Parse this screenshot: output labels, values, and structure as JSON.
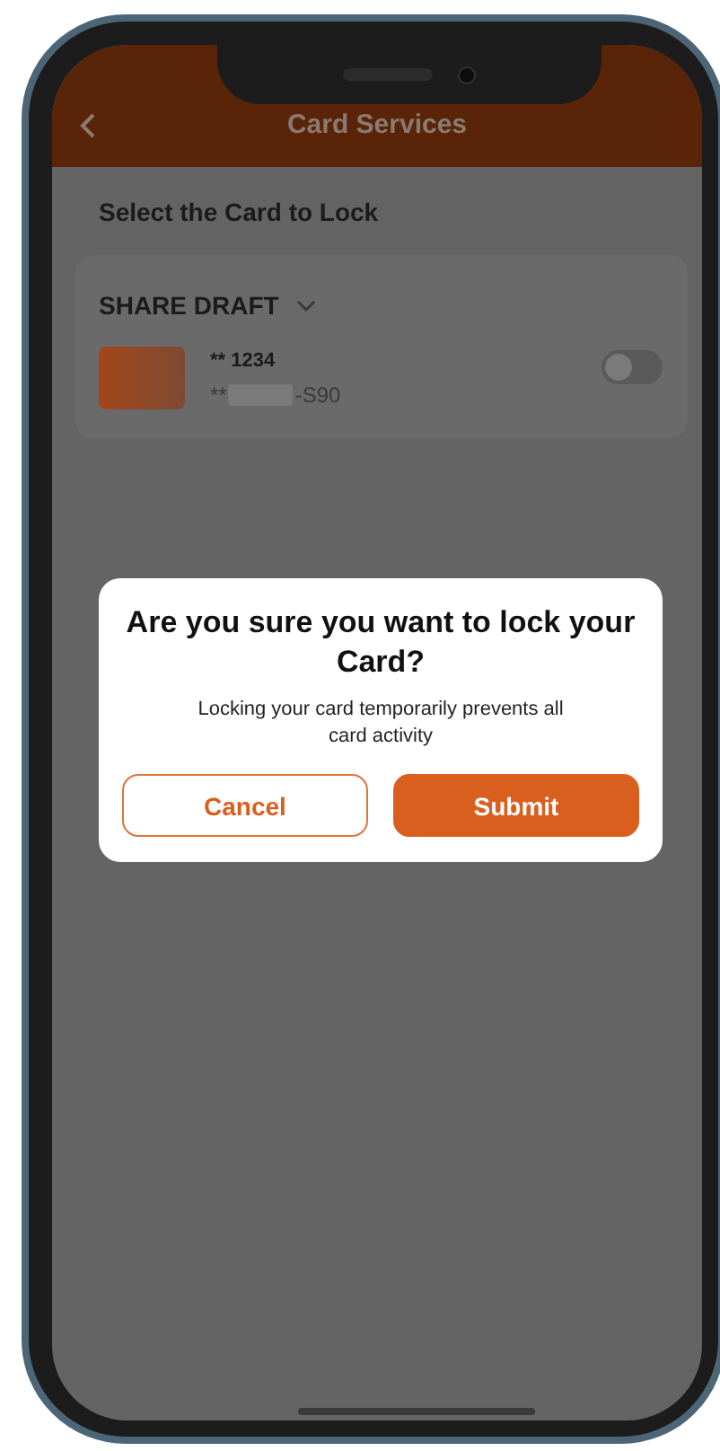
{
  "header": {
    "title": "Card Services"
  },
  "section_title": "Select the Card to Lock",
  "account": {
    "name": "SHARE DRAFT",
    "cards": [
      {
        "number": "** 1234",
        "masked": "**",
        "suffix": "-S90",
        "on": false
      }
    ]
  },
  "dialog": {
    "title": "Are you sure you want to lock your Card?",
    "message": "Locking your card temporarily prevents all card activity",
    "buttons": [
      {
        "label": "Cancel",
        "kind": "secondary"
      },
      {
        "label": "Submit",
        "kind": "primary"
      }
    ]
  }
}
